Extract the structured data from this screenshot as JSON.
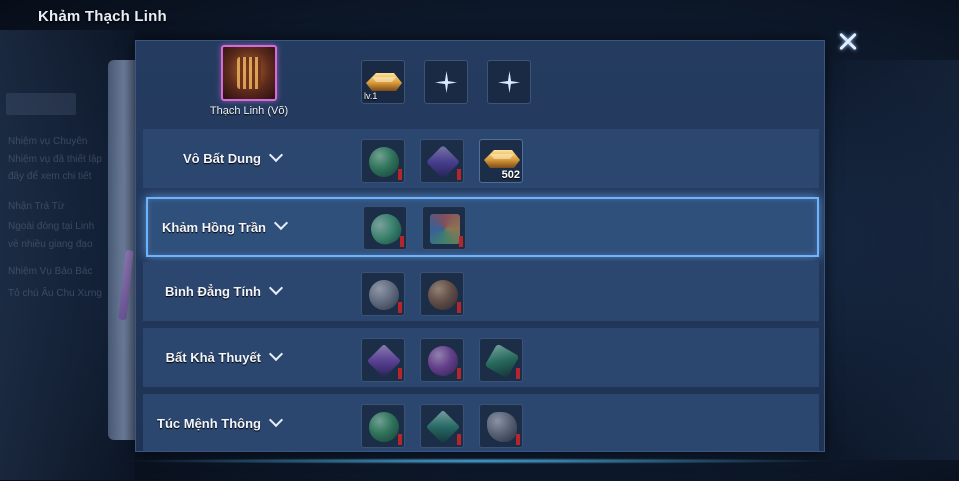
{
  "window": {
    "title": "Khảm Thạch Linh"
  },
  "background_text": [
    "Nhiệm vụ Chuyên",
    "Nhiệm vụ đã thiết lập",
    "đây để xem chi tiết",
    "Nhận Trả Từ",
    "Ngoài đóng tại Linh",
    "vẻ nhiều giang đạo",
    "Nhiệm Vụ Bảo Bác",
    "Tỏ chú Âu Chu Xưng"
  ],
  "hero": {
    "name": "Thạch Linh (Võ)",
    "slots": [
      {
        "type": "item",
        "icon": "gold-ingot-icon",
        "level": "lv.1"
      },
      {
        "type": "empty",
        "icon": "plus-icon"
      },
      {
        "type": "empty",
        "icon": "plus-icon"
      }
    ]
  },
  "rows": [
    {
      "label": "Vô Bất Dung",
      "selected": false,
      "gems": [
        {
          "icon": "green-orb-icon",
          "color": "#3fae6a",
          "locked": true,
          "count": ""
        },
        {
          "icon": "purple-crystal-icon",
          "color": "#6a4bc4",
          "locked": true,
          "count": ""
        },
        {
          "icon": "gold-ingot-icon",
          "color": "#e2a94a",
          "locked": false,
          "count": "502"
        }
      ]
    },
    {
      "label": "Khảm Hồng Trần",
      "selected": true,
      "gems": [
        {
          "icon": "jade-oval-icon",
          "color": "#4fc48a",
          "locked": true,
          "count": ""
        },
        {
          "icon": "prism-cube-icon",
          "color": "#d96a6a",
          "locked": true,
          "count": ""
        }
      ]
    },
    {
      "label": "Bình Đẳng Tính",
      "selected": false,
      "gems": [
        {
          "icon": "grey-pearl-icon",
          "color": "#9aa0ad",
          "locked": true,
          "count": ""
        },
        {
          "icon": "amber-orb-icon",
          "color": "#9a6a48",
          "locked": true,
          "count": ""
        }
      ]
    },
    {
      "label": "Bất Khả Thuyết",
      "selected": false,
      "gems": [
        {
          "icon": "purple-gem-icon",
          "color": "#8a4fd0",
          "locked": true,
          "count": ""
        },
        {
          "icon": "violet-orb-icon",
          "color": "#a04fc4",
          "locked": true,
          "count": ""
        },
        {
          "icon": "emerald-crystal-icon",
          "color": "#2f9a6a",
          "locked": true,
          "count": ""
        }
      ]
    },
    {
      "label": "Túc Mệnh Thông",
      "selected": false,
      "gems": [
        {
          "icon": "green-orb-icon",
          "color": "#3fae6a",
          "locked": true,
          "count": ""
        },
        {
          "icon": "green-crystal-icon",
          "color": "#2f9a7a",
          "locked": true,
          "count": ""
        },
        {
          "icon": "grey-rock-icon",
          "color": "#8d8f9c",
          "locked": true,
          "count": ""
        }
      ]
    }
  ]
}
